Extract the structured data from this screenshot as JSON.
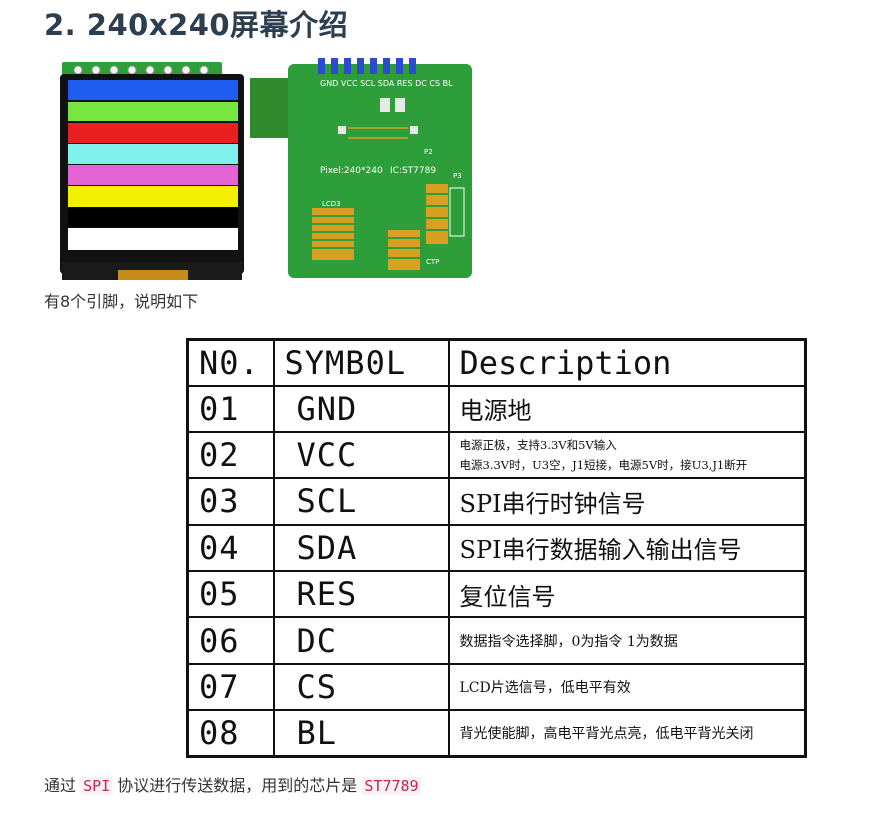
{
  "heading": "2. 240x240屏幕介绍",
  "caption": "有8个引脚，说明如下",
  "pcb": {
    "pins_label": "GND VCC SCL SDA RES DC CS BL",
    "model_text": "Pixel:240*240",
    "ic_text": "IC:ST7789",
    "lcd_label": "LCD3",
    "ctp_label": "CTP",
    "p2": "P2",
    "p3": "P3"
  },
  "table": {
    "headers": [
      "N0.",
      "SYMB0L",
      "Description"
    ],
    "rows": [
      {
        "no": "01",
        "symbol": "GND",
        "desc": "电源地",
        "size": "big"
      },
      {
        "no": "02",
        "symbol": "VCC",
        "desc": "电源正极，支持3.3V和5V输入",
        "desc2": "电源3.3V时，U3空，J1短接，电源5V时，接U3,J1断开",
        "size": "tiny"
      },
      {
        "no": "03",
        "symbol": "SCL",
        "desc": "SPI串行时钟信号",
        "size": "big"
      },
      {
        "no": "04",
        "symbol": "SDA",
        "desc": "SPI串行数据输入输出信号",
        "size": "big"
      },
      {
        "no": "05",
        "symbol": "RES",
        "desc": "复位信号",
        "size": "big"
      },
      {
        "no": "06",
        "symbol": "DC",
        "desc": "数据指令选择脚，0为指令 1为数据",
        "size": "small"
      },
      {
        "no": "07",
        "symbol": "CS",
        "desc": "LCD片选信号，低电平有效",
        "size": "small"
      },
      {
        "no": "08",
        "symbol": "BL",
        "desc": "背光使能脚，高电平背光点亮，低电平背光关闭",
        "size": "small"
      }
    ]
  },
  "footer": {
    "part1": "通过",
    "code1": "SPI",
    "part2": "协议进行传送数据，用到的芯片是",
    "code2": "ST7789"
  },
  "colors": {
    "bars": [
      "#1f5cf2",
      "#77e640",
      "#e82020",
      "#7ff2ee",
      "#e464d6",
      "#f4f000",
      "#000000",
      "#ffffff"
    ],
    "pcb_green": "#2e9e3a",
    "gold": "#d8a020",
    "code_text": "#c7254e"
  }
}
